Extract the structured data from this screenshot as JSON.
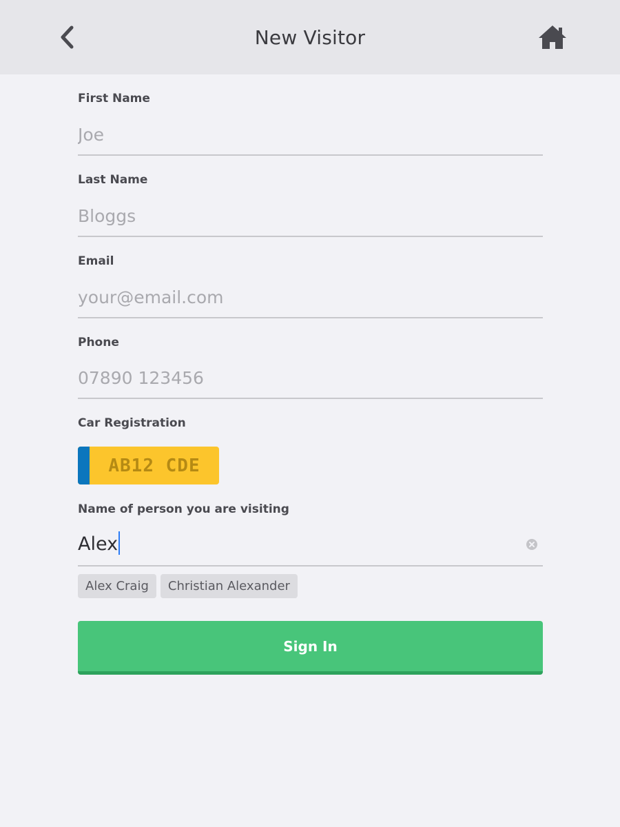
{
  "header": {
    "title": "New Visitor",
    "back_icon": "chevron-left-icon",
    "home_icon": "home-icon"
  },
  "form": {
    "first_name": {
      "label": "First Name",
      "value": "",
      "placeholder": "Joe"
    },
    "last_name": {
      "label": "Last Name",
      "value": "",
      "placeholder": "Bloggs"
    },
    "email": {
      "label": "Email",
      "value": "",
      "placeholder": "your@email.com"
    },
    "phone": {
      "label": "Phone",
      "value": "",
      "placeholder": "07890 123456"
    },
    "car_registration": {
      "label": "Car Registration",
      "placeholder": "AB12 CDE"
    },
    "visiting": {
      "label": "Name of person you are visiting",
      "value": "Alex",
      "suggestions": [
        "Alex Craig",
        "Christian Alexander"
      ]
    }
  },
  "actions": {
    "sign_in_label": "Sign In"
  },
  "colors": {
    "primary_button": "#48c57a",
    "plate_yellow": "#fcc52c",
    "plate_blue": "#0b76bd",
    "caret": "#2b7cf6"
  }
}
